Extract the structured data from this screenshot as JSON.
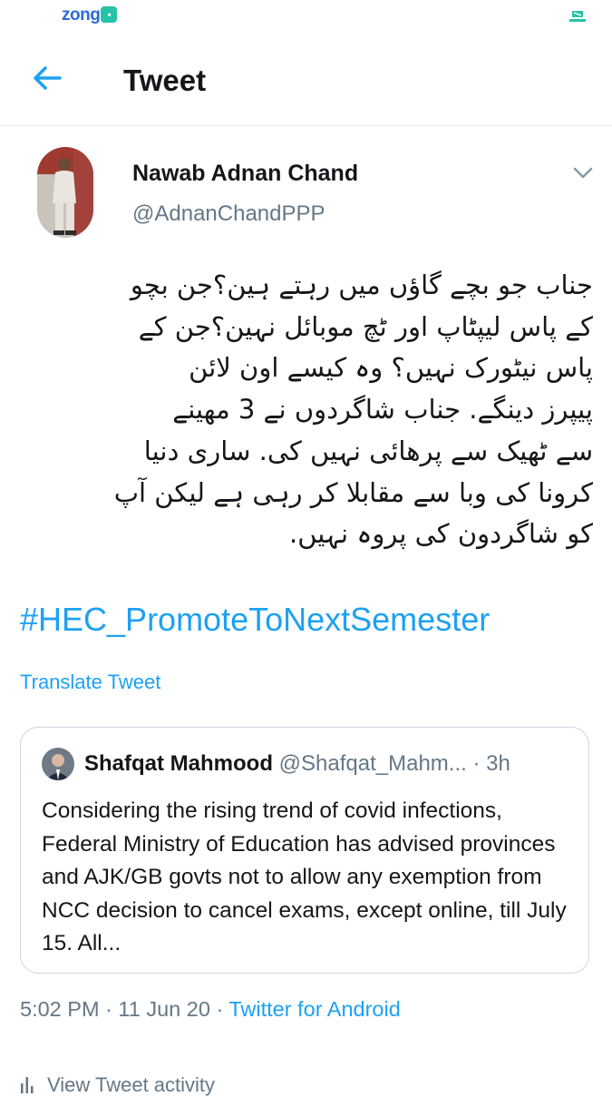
{
  "status_bar": {
    "carrier": "zong",
    "carrier_badge": "•"
  },
  "header": {
    "title": "Tweet"
  },
  "tweet": {
    "author": {
      "name": "Nawab Adnan Chand",
      "handle": "@AdnanChandPPP"
    },
    "text_lines": [
      "جناب جو بچے گاؤں میں رہتے ہین؟جن بچو",
      "کے پاس لیپٹاپ اور ٹچ موبائل نہین؟جن کے",
      "پاس نیٹورک نہیں؟ وہ کیسے اون لائن",
      "پیپرز دینگے. جناب شاگردوں نے 3 مھینے",
      "سے ٹھیک سے پرھائی نہیں کی. ساری دنیا",
      "کرونا کی وبا سے مقابلا کر رہی ہے لیکن آپ",
      "کو شاگردون کی پروہ نہیں."
    ],
    "hashtag": "#HEC_PromoteToNextSemester",
    "translate_label": "Translate Tweet"
  },
  "quoted_tweet": {
    "name": "Shafqat Mahmood",
    "handle": "@Shafqat_Mahm...",
    "separator": "·",
    "time": "3h",
    "text": "Considering the rising trend of covid infections, Federal Ministry of Education has advised provinces and AJK/GB govts not to allow any exemption from NCC decision to cancel exams, except online, till July 15. All..."
  },
  "meta": {
    "time": "5:02 PM",
    "date": "11 Jun 20",
    "separator": "·",
    "source": "Twitter for Android"
  },
  "activity": {
    "label": "View Tweet activity",
    "icon": "bar-chart-icon"
  },
  "colors": {
    "accent": "#1da1f2",
    "muted": "#657786",
    "text": "#14171a",
    "border": "#e1e8ed"
  }
}
